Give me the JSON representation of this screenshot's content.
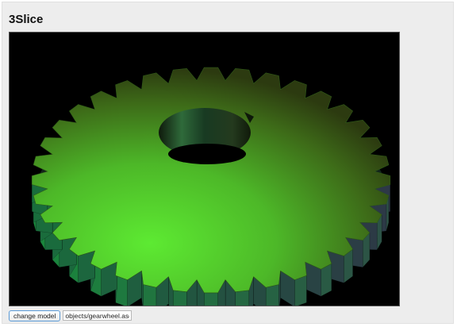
{
  "app": {
    "title": "3Slice"
  },
  "viewer": {
    "model_description": "green 3D gear wheel rendering",
    "colors": {
      "background": "#000000",
      "gear_light": "#5dea32",
      "gear_dark": "#2c3a10",
      "gear_side": "#2e5a48"
    },
    "tooth_count": 36
  },
  "controls": {
    "change_model_label": "change model",
    "model_path_value": "objects/gearwheel.ascii.stl"
  }
}
